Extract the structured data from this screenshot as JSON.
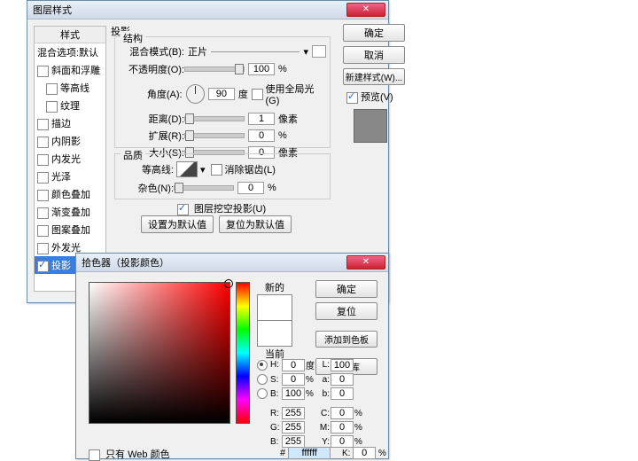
{
  "win1": {
    "title": "图层样式",
    "styles_header": "样式",
    "styles_blend": "混合选项:默认",
    "styles_items": [
      {
        "label": "斜面和浮雕",
        "checked": false,
        "indent": 0
      },
      {
        "label": "等高线",
        "checked": false,
        "indent": 1
      },
      {
        "label": "纹理",
        "checked": false,
        "indent": 1
      },
      {
        "label": "描边",
        "checked": false,
        "indent": 0
      },
      {
        "label": "内阴影",
        "checked": false,
        "indent": 0
      },
      {
        "label": "内发光",
        "checked": false,
        "indent": 0
      },
      {
        "label": "光泽",
        "checked": false,
        "indent": 0
      },
      {
        "label": "颜色叠加",
        "checked": false,
        "indent": 0
      },
      {
        "label": "渐变叠加",
        "checked": false,
        "indent": 0
      },
      {
        "label": "图案叠加",
        "checked": false,
        "indent": 0
      },
      {
        "label": "外发光",
        "checked": false,
        "indent": 0
      },
      {
        "label": "投影",
        "checked": true,
        "indent": 0,
        "selected": true
      }
    ],
    "section_title": "投影",
    "group_struct": "结构",
    "blend_mode_label": "混合模式(B):",
    "blend_mode_value": "正片",
    "opacity_label": "不透明度(O):",
    "opacity_value": "100",
    "pct": "%",
    "angle_label": "角度(A):",
    "angle_value": "90",
    "angle_unit": "度",
    "use_global": "使用全局光(G)",
    "distance_label": "距离(D):",
    "distance_value": "1",
    "px": "像素",
    "spread_label": "扩展(R):",
    "spread_value": "0",
    "size_label": "大小(S):",
    "size_value": "0",
    "group_quality": "品质",
    "contour_label": "等高线:",
    "antialias": "消除锯齿(L)",
    "noise_label": "杂色(N):",
    "noise_value": "0",
    "knockout": "图层挖空投影(U)",
    "btn_default": "设置为默认值",
    "btn_reset": "复位为默认值",
    "btn_ok": "确定",
    "btn_cancel": "取消",
    "btn_newstyle": "新建样式(W)...",
    "preview": "预览(V)"
  },
  "win2": {
    "title": "拾色器（投影颜色）",
    "new_label": "新的",
    "current_label": "当前",
    "btn_ok": "确定",
    "btn_cancel": "复位",
    "btn_add": "添加到色板",
    "btn_lib": "颜色库",
    "only_web": "只有 Web 颜色",
    "hex_value": "ffffff",
    "rows": [
      {
        "l": "H:",
        "lv": "0",
        "lu": "度",
        "r": "L:",
        "rv": "100"
      },
      {
        "l": "S:",
        "lv": "0",
        "lu": "%",
        "r": "a:",
        "rv": "0"
      },
      {
        "l": "B:",
        "lv": "100",
        "lu": "%",
        "r": "b:",
        "rv": "0"
      },
      {
        "l": "R:",
        "lv": "255",
        "lu": "",
        "r": "C:",
        "rv": "0",
        "ru": "%"
      },
      {
        "l": "G:",
        "lv": "255",
        "lu": "",
        "r": "M:",
        "rv": "0",
        "ru": "%"
      },
      {
        "l": "B:",
        "lv": "255",
        "lu": "",
        "r": "Y:",
        "rv": "0",
        "ru": "%"
      }
    ],
    "k_label": "K:",
    "k_value": "0"
  }
}
